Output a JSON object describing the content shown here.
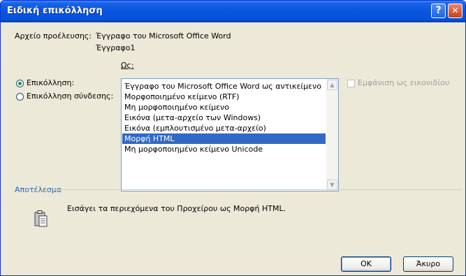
{
  "window": {
    "title": "Ειδική επικόλληση",
    "help_glyph": "?",
    "close_glyph": "✕"
  },
  "source": {
    "label": "Αρχείο προέλευσης:",
    "line1": "Έγγραφο του Microsoft Office Word",
    "line2": "Έγγραφο1"
  },
  "as_label": "Ως:",
  "options": {
    "paste_label": "Επικόλληση:",
    "paste_link_label": "Επικόλληση σύνδεσης:",
    "selected": "paste"
  },
  "formats": {
    "items": [
      "Έγγραφο του Microsoft Office Word ως αντικείμενο",
      "Μορφοποιημένο κείμενο (RTF)",
      "Μη μορφοποιημένο κείμενο",
      "Εικόνα (μετα-αρχείο των Windows)",
      "Εικόνα (εμπλουτισμένο μετα-αρχείο)",
      "Μορφή HTML",
      "Μη μορφοποιημένο κείμενο Unicode"
    ],
    "selected_index": 5
  },
  "display_as_icon": {
    "label": "Εμφάνιση ως εικονιδίου",
    "checked": false,
    "enabled": false
  },
  "result": {
    "heading": "Αποτέλεσμα",
    "text": "Εισάγει τα περιεχόμενα του Προχείρου ως Μορφή HTML.",
    "icon": "clipboard-icon"
  },
  "buttons": {
    "ok": "OK",
    "cancel": "Άκυρο"
  },
  "colors": {
    "title_bar": "#0a55e0",
    "selection": "#316ac5",
    "result_heading": "#3264b4"
  }
}
